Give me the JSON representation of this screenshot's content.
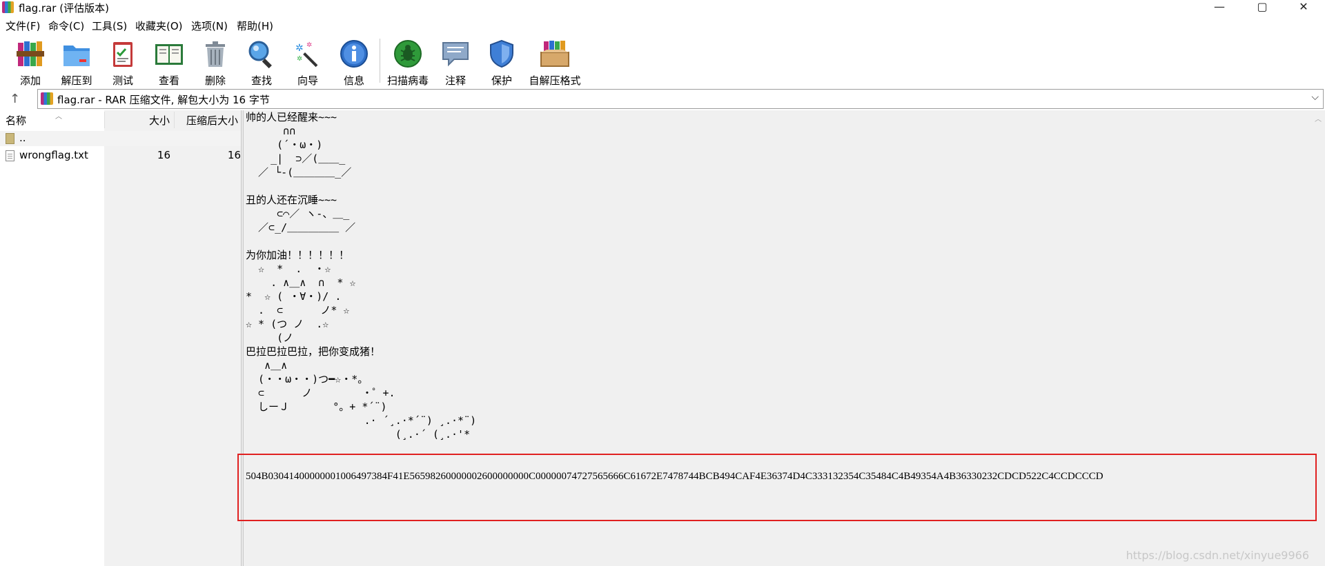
{
  "window": {
    "title": "flag.rar (评估版本)",
    "minimize": "—",
    "maximize": "▢",
    "close": "✕"
  },
  "menu": [
    "文件(F)",
    "命令(C)",
    "工具(S)",
    "收藏夹(O)",
    "选项(N)",
    "帮助(H)"
  ],
  "toolbar": [
    {
      "label": "添加",
      "icon": "add-books-icon"
    },
    {
      "label": "解压到",
      "icon": "extract-folder-icon"
    },
    {
      "label": "测试",
      "icon": "test-clipboard-icon"
    },
    {
      "label": "查看",
      "icon": "view-book-icon"
    },
    {
      "label": "删除",
      "icon": "trash-icon"
    },
    {
      "label": "查找",
      "icon": "magnifier-icon"
    },
    {
      "label": "向导",
      "icon": "wizard-wand-icon"
    },
    {
      "label": "信息",
      "icon": "info-icon"
    },
    {
      "label": "扫描病毒",
      "icon": "virus-scan-icon"
    },
    {
      "label": "注释",
      "icon": "comment-icon"
    },
    {
      "label": "保护",
      "icon": "shield-icon"
    },
    {
      "label": "自解压格式",
      "icon": "sfx-box-icon"
    }
  ],
  "address": {
    "up": "↑",
    "text": "flag.rar - RAR 压缩文件, 解包大小为 16 字节",
    "dropdown": "⌵"
  },
  "filelist": {
    "columns": {
      "name": "名称",
      "size": "大小",
      "packed": "压缩后大小"
    },
    "updir": "..",
    "files": [
      {
        "name": "wrongflag.txt",
        "size": "16",
        "packed": "16"
      }
    ]
  },
  "comment": {
    "text": "帅的人已经醒来~~~\n      ∩∩\n     (´・ω・)\n    _|  ⊃／(＿＿_\n  ／ └-(＿＿＿＿_／\n \n丑的人还在沉睡~~~\n     ⊂⌒／ ヽ-、＿_\n  ／⊂_/＿＿＿＿＿ ／\n \n为你加油！！！！！！\n  ☆  *  .  ・☆\n    . ∧＿∧  ∩  * ☆\n*  ☆ ( ・∀・)/ .\n  .  ⊂      ノ* ☆\n☆ * (つ ノ  .☆\n     (ノ\n巴拉巴拉巴拉，把你变成猪！\n   ∧＿∧\n  (・・ω・・)つ━☆・*。\n  ⊂      ノ        ・゜+.\n  しーＪ       °。+ *´¨)\n                   .· ´¸.·*´¨) ¸.·*¨)\n                        (¸.·´ (¸.·'*",
    "hex": "504B03041400000001006497384F41E56598260000002600000000C00000074727565666C61672E7478744BCB494CAF4E36374D4C333132354C35484C4B49354A4B36330232CDCD522C4CCDCCCD"
  },
  "watermark": "https://blog.csdn.net/xinyue9966"
}
